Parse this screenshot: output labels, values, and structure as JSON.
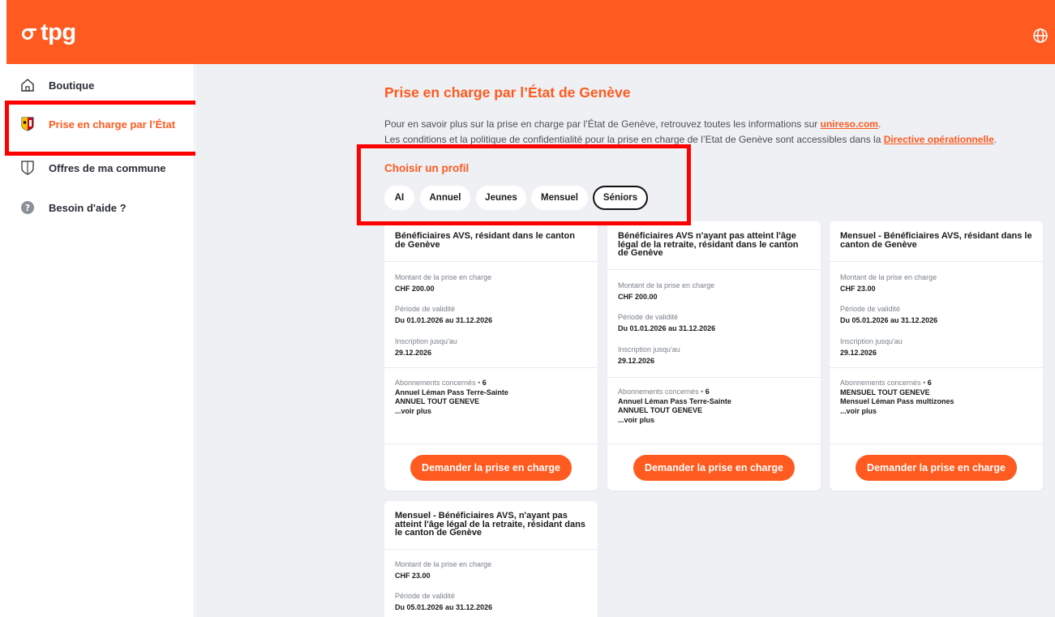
{
  "header": {
    "logo": "tpg",
    "language_icon": "globe-icon"
  },
  "sidebar": {
    "items": [
      {
        "label": "Boutique",
        "icon": "home-icon"
      },
      {
        "label": "Prise en charge par l’État",
        "icon": "geneva-crest-icon"
      },
      {
        "label": "Offres de ma commune",
        "icon": "shield-icon"
      },
      {
        "label": "Besoin d'aide ?",
        "icon": "help-icon"
      }
    ]
  },
  "main": {
    "title": "Prise en charge par l’État de Genève",
    "intro_line1_text": "Pour en savoir plus sur la prise en charge par l’État de Genève, retrouvez toutes les informations sur ",
    "intro_line1_link": "unireso.com",
    "intro_line1_end": ".",
    "intro_line2_text": "Les conditions et la politique de confidentialité pour la prise en charge de l’Etat de Genève sont accessibles dans la ",
    "intro_line2_link": "Directive opérationnelle",
    "intro_line2_end": ".",
    "profile_title": "Choisir un profil",
    "profiles": [
      "AI",
      "Annuel",
      "Jeunes",
      "Mensuel",
      "Séniors"
    ],
    "selected_profile": "Séniors"
  },
  "cards": [
    {
      "title": "Bénéficiaires AVS, résidant dans le canton de Genève",
      "amount_label": "Montant de la prise en charge",
      "amount": "CHF 200.00",
      "validity_label": "Période de validité",
      "validity": "Du 01.01.2026 au 31.12.2026",
      "signup_label": "Inscription jusqu'au",
      "signup": "29.12.2026",
      "subs_label": "Abonnements concernés • ",
      "subs_count": "6",
      "subs": [
        "Annuel Léman Pass Terre-Sainte",
        "ANNUEL TOUT GENEVE"
      ],
      "more": "...voir plus",
      "button": "Demander la prise en charge"
    },
    {
      "title": "Bénéficiaires AVS n'ayant pas atteint l'âge légal de la retraite, résidant dans le canton de Genève",
      "amount_label": "Montant de la prise en charge",
      "amount": "CHF 200.00",
      "validity_label": "Période de validité",
      "validity": "Du 01.01.2026 au 31.12.2026",
      "signup_label": "Inscription jusqu'au",
      "signup": "29.12.2026",
      "subs_label": "Abonnements concernés • ",
      "subs_count": "6",
      "subs": [
        "Annuel Léman Pass Terre-Sainte",
        "ANNUEL TOUT GENEVE"
      ],
      "more": "...voir plus",
      "button": "Demander la prise en charge"
    },
    {
      "title": "Mensuel - Bénéficiaires AVS, résidant dans le canton de Genève",
      "amount_label": "Montant de la prise en charge",
      "amount": "CHF 23.00",
      "validity_label": "Période de validité",
      "validity": "Du 05.01.2026 au 31.12.2026",
      "signup_label": "Inscription jusqu'au",
      "signup": "29.12.2026",
      "subs_label": "Abonnements concernés • ",
      "subs_count": "6",
      "subs": [
        "MENSUEL TOUT GENEVE",
        "Mensuel Léman Pass multizones"
      ],
      "more": "...voir plus",
      "button": "Demander la prise en charge"
    },
    {
      "title": "Mensuel - Bénéficiaires AVS, n'ayant pas atteint l'âge légal de la retraite, résidant dans le canton de Genève",
      "amount_label": "Montant de la prise en charge",
      "amount": "CHF 23.00",
      "validity_label": "Période de validité",
      "validity": "Du 05.01.2026 au 31.12.2026"
    }
  ],
  "colors": {
    "brand": "#ff5a1f",
    "highlight": "#ff0000",
    "background": "#eef0f4"
  }
}
